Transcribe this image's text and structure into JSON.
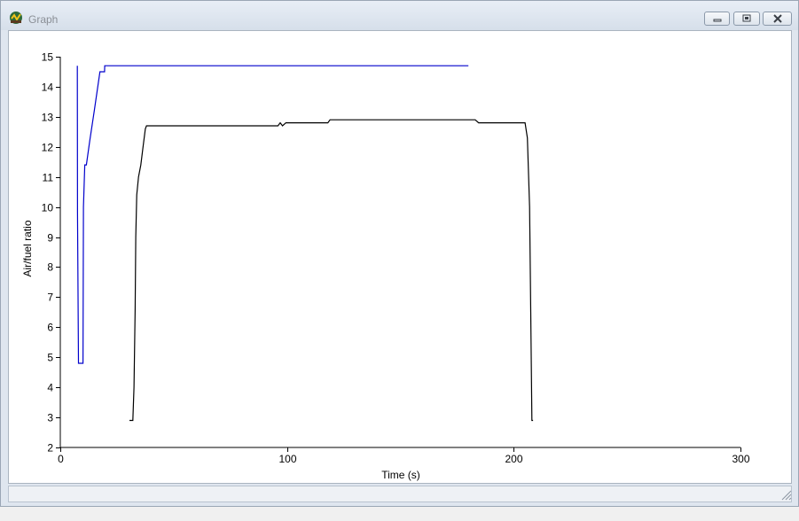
{
  "window": {
    "title": "Graph",
    "icons": {
      "app": "graph-app-icon",
      "minimize": "minimize-icon",
      "maximize": "maximize-icon",
      "close": "close-icon",
      "resize_grip": "resize-grip-icon"
    }
  },
  "chart_data": {
    "type": "line",
    "xlabel": "Time (s)",
    "ylabel": "Air/fuel ratio",
    "xlim": [
      0,
      300
    ],
    "ylim": [
      2,
      15
    ],
    "x_ticks": [
      0,
      100,
      200,
      300
    ],
    "y_ticks": [
      2,
      3,
      4,
      5,
      6,
      7,
      8,
      9,
      10,
      11,
      12,
      13,
      14,
      15
    ],
    "grid": false,
    "series": [
      {
        "color": "#0000cc",
        "points": [
          [
            7.5,
            14.7
          ],
          [
            7.6,
            9.8
          ],
          [
            8.0,
            4.8
          ],
          [
            10.0,
            4.8
          ],
          [
            10.2,
            10.0
          ],
          [
            10.8,
            11.4
          ],
          [
            11.5,
            11.4
          ],
          [
            13.0,
            12.2
          ],
          [
            15.0,
            13.2
          ],
          [
            17.5,
            14.5
          ],
          [
            19.5,
            14.5
          ],
          [
            19.6,
            14.7
          ],
          [
            180,
            14.7
          ]
        ]
      },
      {
        "color": "#000000",
        "points": [
          [
            30.5,
            2.9
          ],
          [
            32.0,
            2.9
          ],
          [
            32.5,
            4.0
          ],
          [
            33.0,
            6.6
          ],
          [
            33.3,
            9.0
          ],
          [
            33.7,
            10.4
          ],
          [
            34.5,
            11.0
          ],
          [
            35.5,
            11.4
          ],
          [
            36.5,
            12.0
          ],
          [
            37.5,
            12.6
          ],
          [
            38.0,
            12.7
          ],
          [
            96.0,
            12.7
          ],
          [
            97.0,
            12.8
          ],
          [
            98.0,
            12.7
          ],
          [
            99.5,
            12.8
          ],
          [
            118.0,
            12.8
          ],
          [
            119.0,
            12.9
          ],
          [
            183.0,
            12.9
          ],
          [
            184.5,
            12.8
          ],
          [
            205.0,
            12.8
          ],
          [
            206.0,
            12.3
          ],
          [
            207.0,
            10.0
          ],
          [
            207.5,
            6.5
          ],
          [
            208.0,
            2.9
          ],
          [
            208.5,
            2.9
          ]
        ]
      }
    ]
  }
}
